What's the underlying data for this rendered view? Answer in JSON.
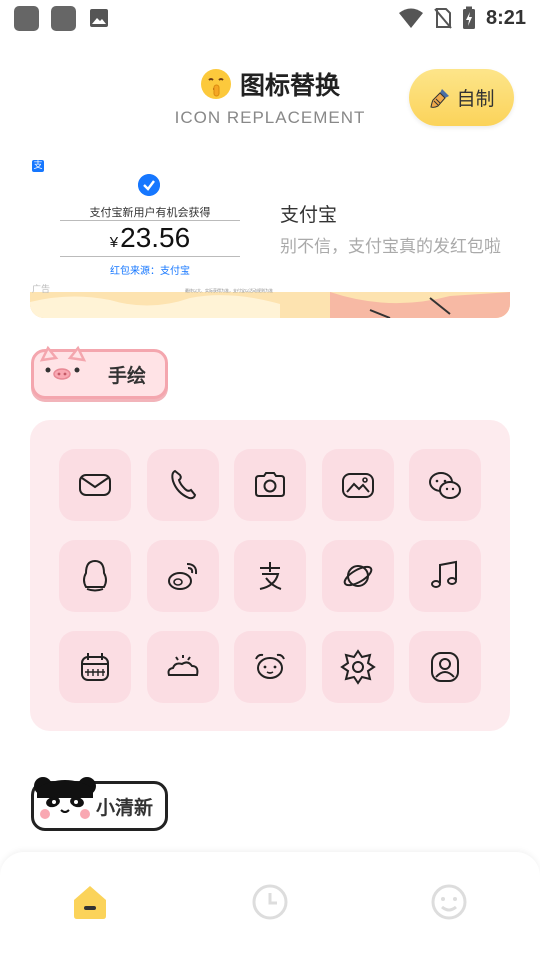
{
  "status_bar": {
    "time": "8:21",
    "icons": [
      "app-notification-icon",
      "app-notification-icon",
      "image-icon",
      "wifi-icon",
      "no-sim-icon",
      "battery-charging-icon"
    ]
  },
  "header": {
    "title": "图标替换",
    "subtitle": "ICON REPLACEMENT",
    "diy_button": "自制",
    "title_icon": "shushing-face-emoji-icon",
    "diy_icon": "brush-icon"
  },
  "ad": {
    "card_line": "支付宝新用户有机会获得",
    "currency": "¥",
    "amount": "23.56",
    "source": "红包来源：支付宝",
    "tag": "广告",
    "fine_print": "最终以大、实际获得为准，支付宝以活动规则为准",
    "name": "支付宝",
    "description": "别不信，支付宝真的发红包啦"
  },
  "sections": [
    {
      "label": "手绘",
      "badge_icon": "pig-face-icon"
    },
    {
      "label": "小清新",
      "badge_icon": "panda-face-icon"
    }
  ],
  "icon_grid": {
    "icons": [
      "mail-icon",
      "phone-icon",
      "camera-icon",
      "gallery-icon",
      "wechat-icon",
      "qq-penguin-icon",
      "weibo-icon",
      "alipay-icon",
      "browser-planet-icon",
      "music-icon",
      "calendar-icon",
      "weather-icon",
      "clock-icon",
      "settings-icon",
      "contacts-icon"
    ]
  },
  "bottom_nav": {
    "items": [
      "home-icon",
      "history-clock-icon",
      "profile-face-icon"
    ],
    "active_index": 0
  },
  "colors": {
    "accent_yellow": "#fbd35a",
    "grid_bg": "#fdebee",
    "icon_tile": "#fbdde3",
    "alipay_blue": "#1677ff"
  }
}
